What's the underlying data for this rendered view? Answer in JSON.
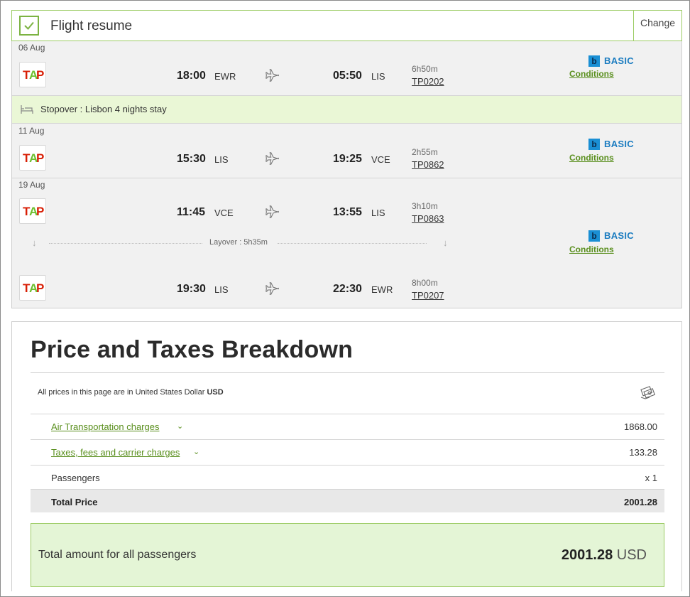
{
  "resume": {
    "title": "Flight resume",
    "change_label": "Change"
  },
  "segments": [
    {
      "date": "06 Aug",
      "dep_time": "18:00",
      "dep_code": "EWR",
      "arr_time": "05:50",
      "arr_code": "LIS",
      "duration": "6h50m",
      "flight_no": "TP0202"
    },
    {
      "date": "11 Aug",
      "dep_time": "15:30",
      "dep_code": "LIS",
      "arr_time": "19:25",
      "arr_code": "VCE",
      "duration": "2h55m",
      "flight_no": "TP0862"
    },
    {
      "date": "19 Aug",
      "dep_time": "11:45",
      "dep_code": "VCE",
      "arr_time": "13:55",
      "arr_code": "LIS",
      "duration": "3h10m",
      "flight_no": "TP0863"
    },
    {
      "date": "",
      "dep_time": "19:30",
      "dep_code": "LIS",
      "arr_time": "22:30",
      "arr_code": "EWR",
      "duration": "8h00m",
      "flight_no": "TP0207"
    }
  ],
  "fare": {
    "badge_letter": "b",
    "name": "BASIC",
    "conditions_label": "Conditions"
  },
  "stopover": {
    "text": "Stopover : Lisbon  4 nights stay"
  },
  "layover": {
    "text": "Layover : 5h35m"
  },
  "price": {
    "title": "Price and Taxes Breakdown",
    "currency_note_prefix": "All prices in this page are in United States Dollar",
    "currency_code": "USD",
    "rows": [
      {
        "label": "Air Transportation charges",
        "value": "1868.00"
      },
      {
        "label": "Taxes, fees and carrier charges",
        "value": "133.28"
      },
      {
        "label": "Passengers",
        "value": "x 1"
      },
      {
        "label": "Total Price",
        "value": "2001.28"
      }
    ],
    "grand_label": "Total amount for all passengers",
    "grand_amount": "2001.28",
    "grand_currency": "USD"
  },
  "colors": {
    "accent_green": "#7cb342",
    "link_green": "#5a8f1e",
    "fare_blue": "#1b7cc0",
    "stopover_bg": "#eaf7d6"
  }
}
